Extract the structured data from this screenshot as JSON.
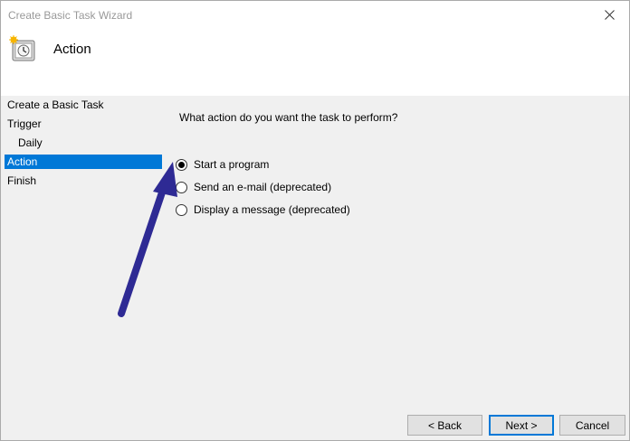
{
  "window": {
    "title": "Create Basic Task Wizard"
  },
  "header": {
    "title": "Action",
    "icon": "task-scheduler-icon"
  },
  "steps": [
    {
      "label": "Create a Basic Task",
      "sub": false,
      "active": false
    },
    {
      "label": "Trigger",
      "sub": false,
      "active": false
    },
    {
      "label": "Daily",
      "sub": true,
      "active": false
    },
    {
      "label": "Action",
      "sub": false,
      "active": true
    },
    {
      "label": "Finish",
      "sub": false,
      "active": false
    }
  ],
  "main": {
    "question": "What action do you want the task to perform?",
    "options": [
      {
        "label": "Start a program",
        "checked": true
      },
      {
        "label": "Send an e-mail (deprecated)",
        "checked": false
      },
      {
        "label": "Display a message (deprecated)",
        "checked": false
      }
    ]
  },
  "buttons": {
    "back": "< Back",
    "next": "Next >",
    "cancel": "Cancel"
  },
  "colors": {
    "accent": "#0078d7",
    "annotation_arrow": "#2e2a94"
  }
}
